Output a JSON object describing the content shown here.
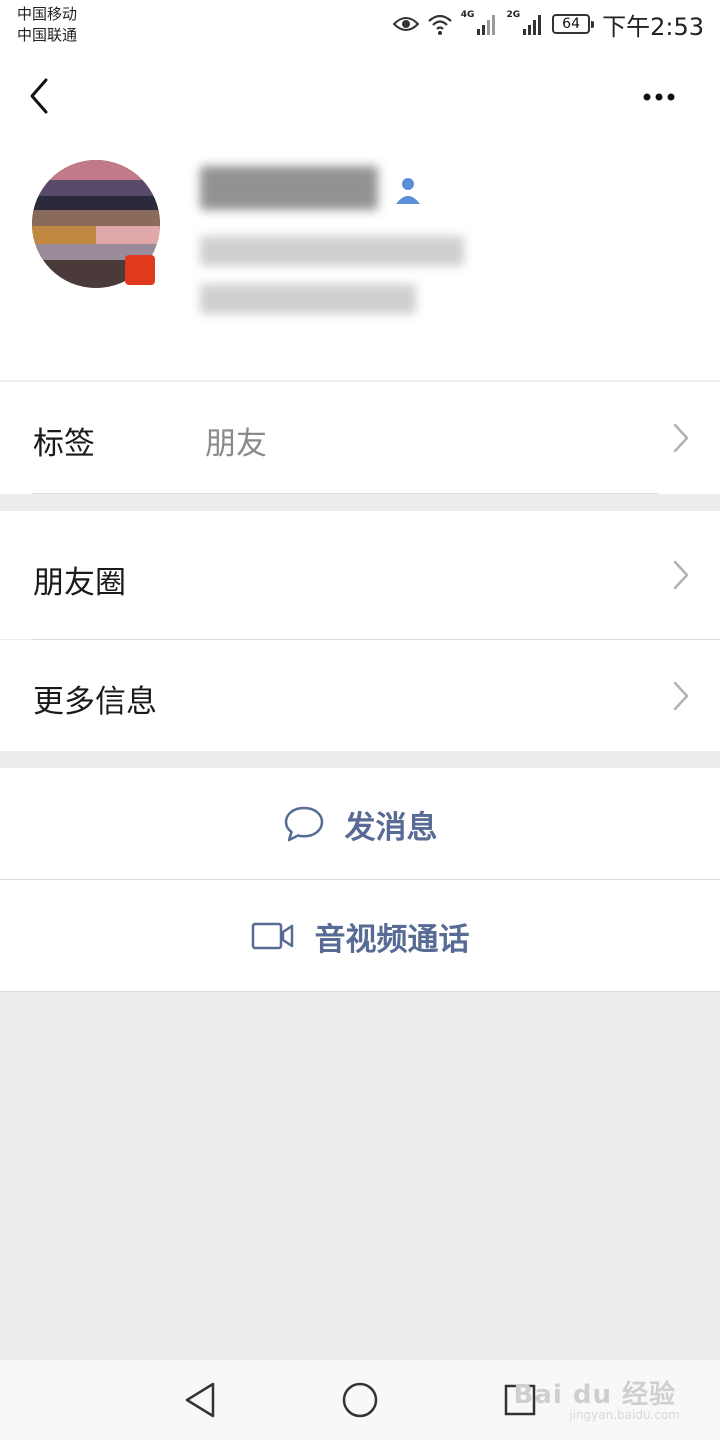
{
  "status_bar": {
    "carrier_1": "中国移动",
    "carrier_2": "中国联通",
    "net_1": "4G",
    "net_2": "2G",
    "battery": "64",
    "time": "下午2:53"
  },
  "header": {
    "back_icon": "chevron-left-icon",
    "more_icon": "ellipsis-icon"
  },
  "profile": {
    "nickname_obscured": true,
    "gender_icon": "male-person-icon"
  },
  "rows": {
    "tags": {
      "label": "标签",
      "value": "朋友"
    },
    "moments": {
      "label": "朋友圈"
    },
    "more_info": {
      "label": "更多信息"
    }
  },
  "actions": {
    "message": {
      "label": "发消息",
      "icon": "chat-bubble-icon"
    },
    "call": {
      "label": "音视频通话",
      "icon": "video-camera-icon"
    }
  },
  "nav": {
    "back": "nav-back-icon",
    "home": "nav-home-icon",
    "recent": "nav-recent-icon"
  },
  "watermark": {
    "text": "Bai du 经验",
    "sub": "jingyan.baidu.com"
  },
  "colors": {
    "accent": "#576b95",
    "background": "#ededed"
  }
}
